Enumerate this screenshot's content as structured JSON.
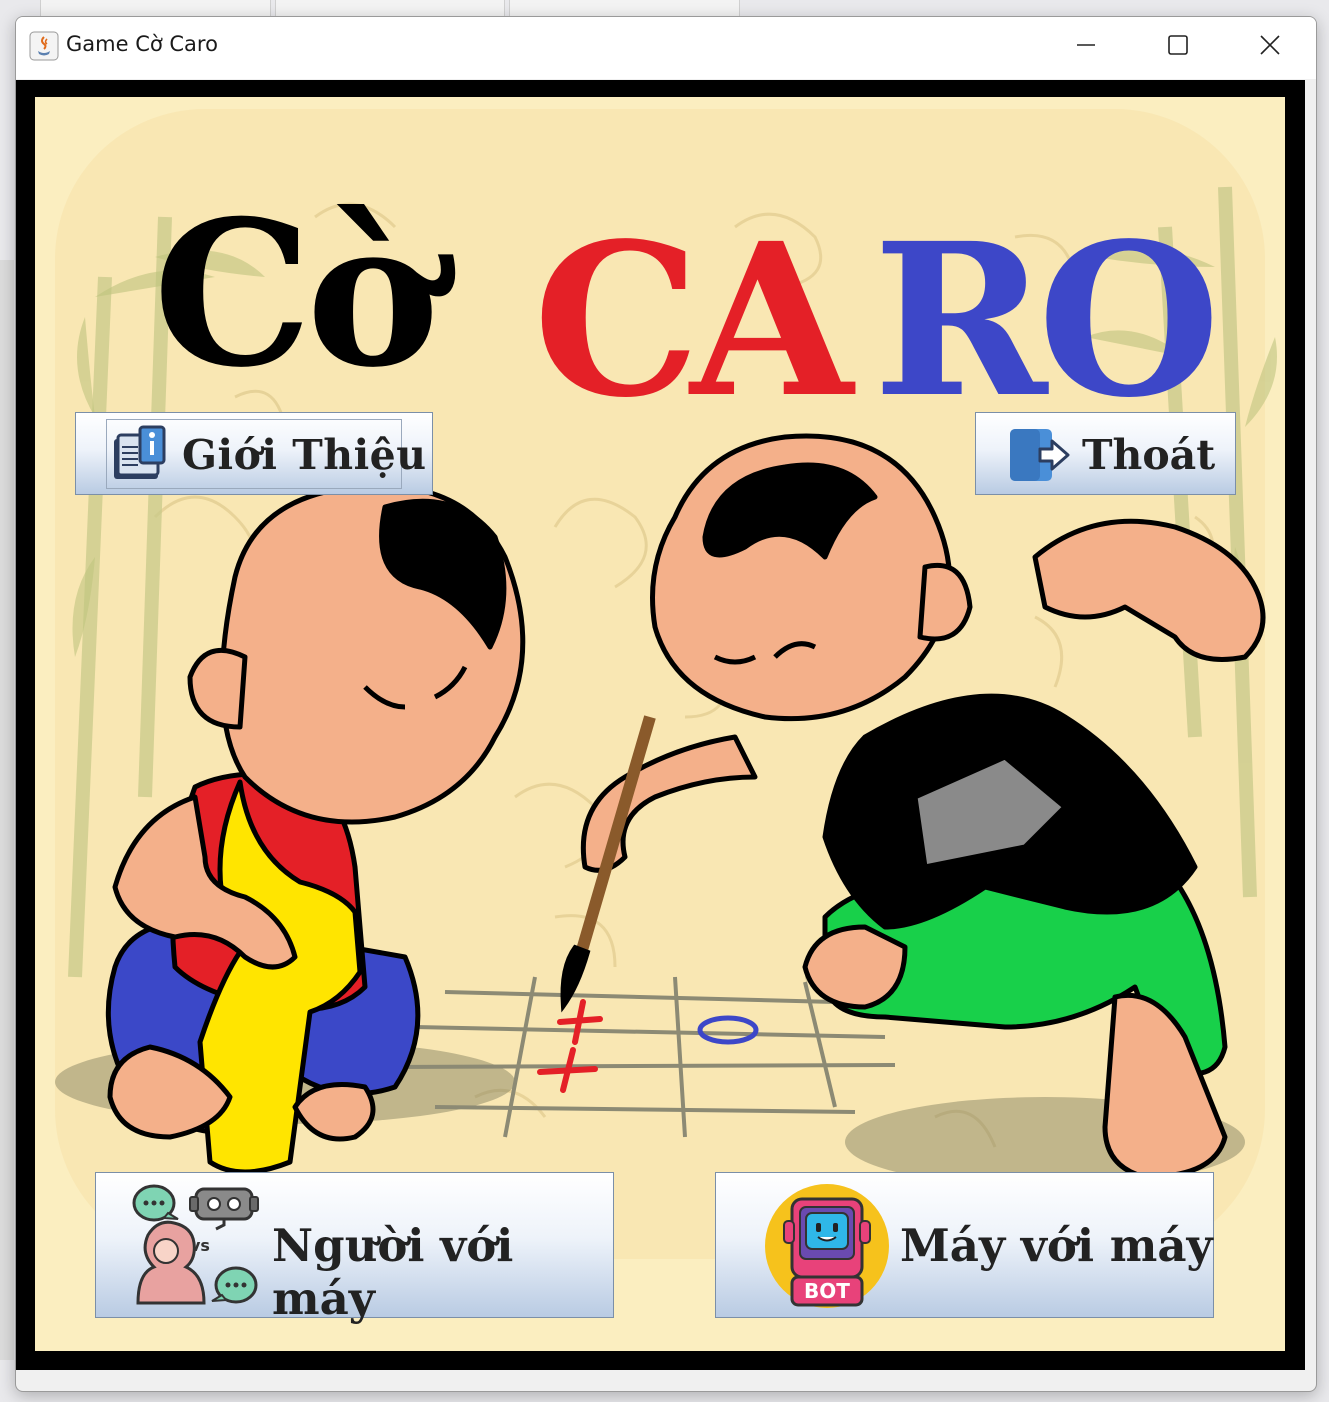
{
  "window": {
    "title": "Game Cờ Caro",
    "controls": {
      "minimize": "minimize",
      "maximize": "maximize",
      "close": "close"
    }
  },
  "logo": {
    "word1": "Cờ",
    "word2_red": "CA",
    "word2_blue": "RO"
  },
  "buttons": {
    "intro": {
      "label": "Giới Thiệu",
      "icon": "info-book-icon"
    },
    "exit": {
      "label": "Thoát",
      "icon": "logout-door-icon"
    },
    "player_vs_computer": {
      "label": "Người với máy",
      "icon": "person-vs-bot-icon"
    },
    "computer_vs_computer": {
      "label": "Máy với máy",
      "icon": "bot-badge-icon",
      "badge_text": "BOT"
    }
  },
  "board_marks": {
    "x_mark": "+",
    "o_mark": "O"
  },
  "colors": {
    "background": "#fbeec0",
    "logo_black": "#000000",
    "logo_red": "#e42027",
    "logo_blue": "#3d47c8",
    "button_gradient_bottom": "#b9cbe3"
  }
}
